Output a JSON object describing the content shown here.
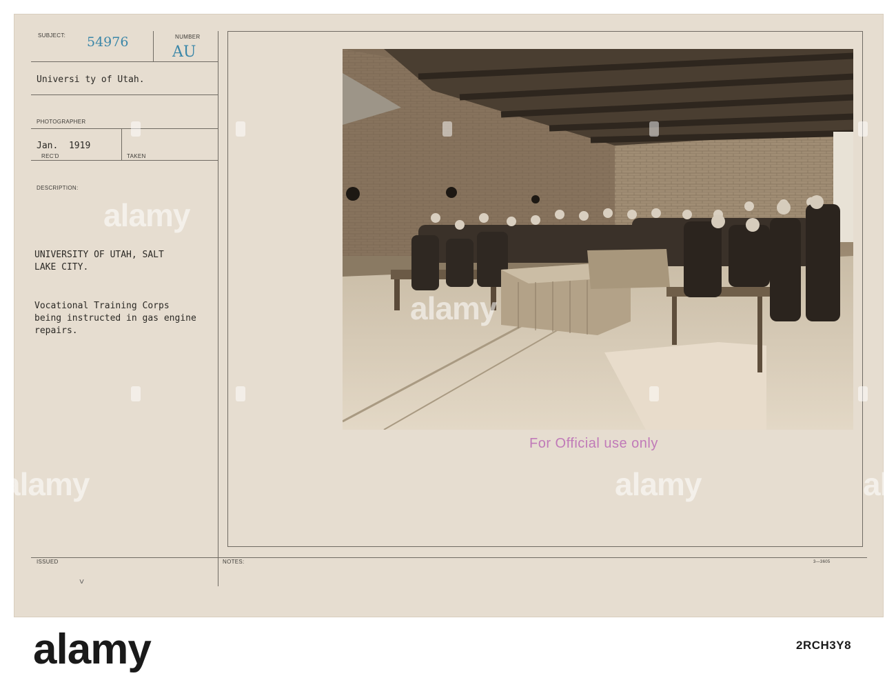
{
  "card": {
    "subject_label": "SUBJECT:",
    "subject_number": "54976",
    "number_label": "NUMBER",
    "number_code": "AU",
    "subject_text": "Universi ty of Utah.",
    "photographer_label": "PHOTOGRAPHER",
    "date": "Jan.  1919",
    "recd_label": "REC'D",
    "taken_label": "TAKEN",
    "description_label": "DESCRIPTION:",
    "description_line1": "UNIVERSITY OF UTAH, SALT",
    "description_line2": "LAKE CITY.",
    "description_line3": "Vocational Training Corps",
    "description_line4": "being instructed in gas engine",
    "description_line5": "repairs.",
    "issued_label": "ISSUED",
    "issued_mark": "<",
    "notes_label": "NOTES:",
    "form_number": "3—3605",
    "stamp_text": "For Official use only"
  },
  "photo": {
    "subject_icon": "workshop-photograph"
  },
  "watermark": {
    "text": "alamy",
    "stock_id": "2RCH3Y8"
  },
  "colors": {
    "card": "#e6ddd0",
    "stamp_blue": "#3a86a8",
    "stamp_purple": "#c07ab8"
  }
}
